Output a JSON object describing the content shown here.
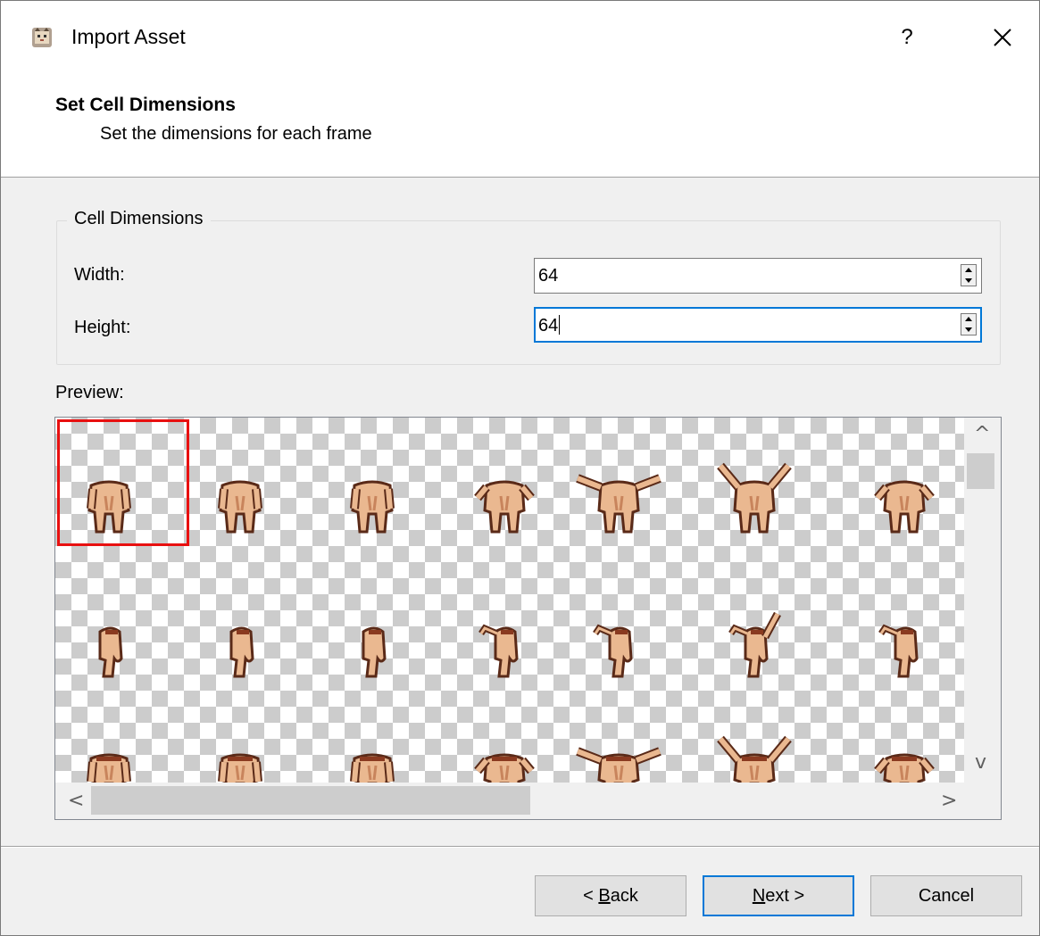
{
  "window": {
    "title": "Import Asset",
    "help_label": "?",
    "close_icon": "close-icon",
    "app_icon": "cat-app-icon"
  },
  "header": {
    "title": "Set Cell Dimensions",
    "subtitle": "Set the dimensions for each frame"
  },
  "cell_dimensions": {
    "legend": "Cell Dimensions",
    "width_label": "Width:",
    "width_value": "64",
    "height_label": "Height:",
    "height_value": "64"
  },
  "preview": {
    "label": "Preview:",
    "selected_frame_color": "#e81010",
    "scroll_up_glyph": "^",
    "scroll_down_glyph": "v",
    "scroll_left_glyph": "<",
    "scroll_right_glyph": ">"
  },
  "buttons": {
    "back_prefix": "< ",
    "back_mnemonic": "B",
    "back_rest": "ack",
    "next_mnemonic": "N",
    "next_rest": "ext >",
    "cancel": "Cancel"
  }
}
